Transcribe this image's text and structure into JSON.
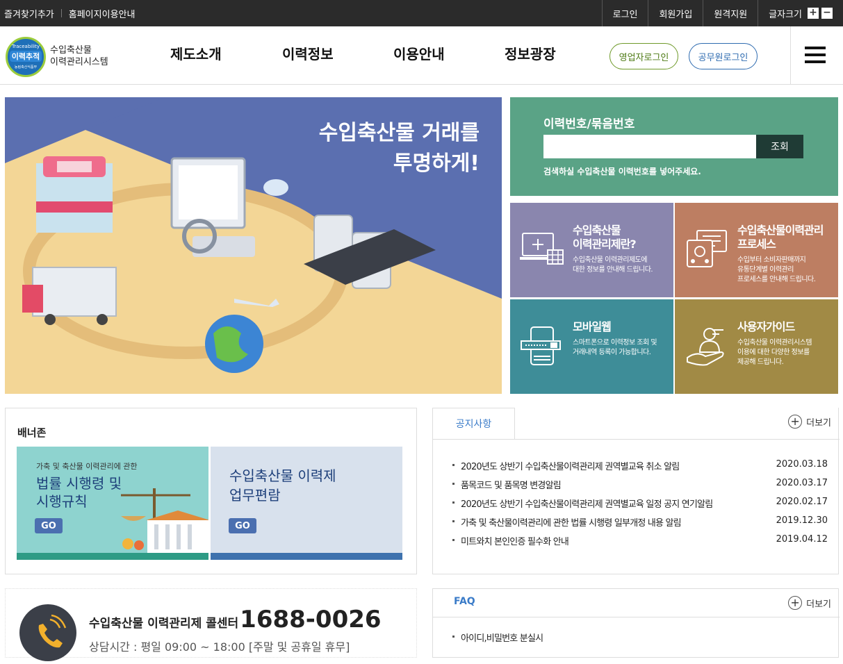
{
  "topbar": {
    "left": [
      "즐겨찾기추가",
      "홈페이지이용안내"
    ],
    "right": [
      "로그인",
      "회원가입",
      "원격지원"
    ],
    "font_size_label": "글자크기",
    "font_plus": "+",
    "font_minus": "−"
  },
  "header": {
    "logo": {
      "top": "Traceability",
      "mid": "이력추적",
      "bottom": "농림축산식품부"
    },
    "site_name_line1": "수입축산물",
    "site_name_line2": "이력관리시스템",
    "nav": [
      "제도소개",
      "이력정보",
      "이용안내",
      "정보광장"
    ],
    "business_login": "영업자로그인",
    "official_login": "공무원로그인",
    "menu_icon": "hamburger-icon"
  },
  "hero": {
    "title_line1": "수입축산물 거래를",
    "title_line2": "투명하게!"
  },
  "search": {
    "label": "이력번호/묶음번호",
    "value": "",
    "placeholder": "",
    "button": "조회",
    "hint": "검색하실 수입축산물 이력번호를 넣어주세요."
  },
  "tiles": [
    {
      "title1": "수입축산물",
      "title2": "이력관리제란?",
      "desc1": "수입축산물 이력관리제도에",
      "desc2": "대한 정보를 안내해 드립니다.",
      "desc3": "",
      "color": "#8a86ae",
      "icon": "monitor-grid-icon"
    },
    {
      "title1": "수입축산물이력관리",
      "title2": "프로세스",
      "desc1": "수입부터 소비자판매까지",
      "desc2": "유통단계별 이력관리",
      "desc3": "프로세스를 안내해 드립니다.",
      "color": "#bd7e62",
      "icon": "process-chart-icon"
    },
    {
      "title1": "모바일웹",
      "title2": "",
      "desc1": "스마트폰으로 이력정보 조회 및",
      "desc2": "거래내역 등록이 가능합니다.",
      "desc3": "",
      "color": "#3e8d98",
      "icon": "mobile-phone-icon"
    },
    {
      "title1": "사용자가이드",
      "title2": "",
      "desc1": "수입축산물 이력관리시스템",
      "desc2": "이용에 대한 다양한 정보를",
      "desc3": "제공해 드립니다.",
      "color": "#a18a45",
      "icon": "hand-user-icon"
    }
  ],
  "banner_zone": {
    "title": "배너존",
    "banners": [
      {
        "small": "가축 및 축산물 이력관리에 관한",
        "line1": "법률 시행령 및",
        "line2": "시행규칙",
        "go": "GO"
      },
      {
        "small": "",
        "line1": "수입축산물 이력제",
        "line2": "업무편람",
        "go": "GO"
      }
    ]
  },
  "notice": {
    "tab": "공지사항",
    "more": "더보기",
    "items": [
      {
        "title": "2020년도 상반기 수입축산물이력관리제 권역별교육 취소 알림",
        "date": "2020.03.18"
      },
      {
        "title": "품목코드 및 품목명 변경알림",
        "date": "2020.03.17"
      },
      {
        "title": "2020년도 상반기 수입축산물이력관리제 권역별교육 일정 공지 연기알림",
        "date": "2020.02.17"
      },
      {
        "title": "가축 및 축산물이력관리에 관한 법률 시행령 일부개정 내용 알림",
        "date": "2019.12.30"
      },
      {
        "title": "미트와치 본인인증 필수화 안내",
        "date": "2019.04.12"
      }
    ]
  },
  "callcenter": {
    "label": "수입축산물 이력관리제 콜센터",
    "number": "1688-0026",
    "hours": "상담시간 : 평일 09:00 ~ 18:00 [주말 및 공휴일 휴무]"
  },
  "faq": {
    "title": "FAQ",
    "more": "더보기",
    "items": [
      "아이디,비밀번호 분실시"
    ]
  },
  "colors": {
    "topbar": "#2b2b2b",
    "search_bg": "#5aa386",
    "search_btn": "#1f3b35",
    "link_blue": "#3a7bc8",
    "business_login_border": "#6f9a2a",
    "official_login_border": "#2e6bb0"
  }
}
